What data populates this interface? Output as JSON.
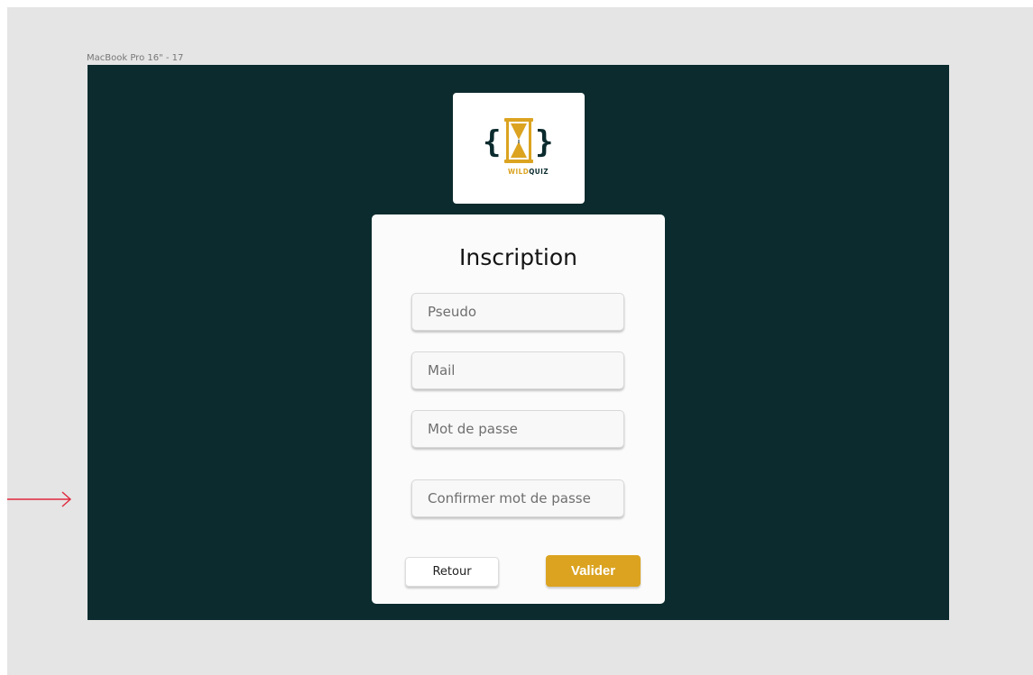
{
  "frame": {
    "label": "MacBook Pro 16\" - 17",
    "background": "#0b2b2e"
  },
  "logo": {
    "icon": "hourglass-braces-logo",
    "brand_primary": "WILD",
    "brand_secondary": "QUIZ",
    "accent_color": "#dba320",
    "dark_color": "#0b2b2e"
  },
  "form": {
    "title": "Inscription",
    "fields": [
      {
        "name": "pseudo",
        "placeholder": "Pseudo",
        "value": ""
      },
      {
        "name": "mail",
        "placeholder": "Mail",
        "value": ""
      },
      {
        "name": "password",
        "placeholder": "Mot de passe",
        "value": ""
      },
      {
        "name": "confirm",
        "placeholder": "Confirmer mot de passe",
        "value": ""
      }
    ],
    "back_label": "Retour",
    "submit_label": "Valider",
    "submit_color": "#dba320"
  },
  "annotation": {
    "icon": "arrow-right-icon",
    "color": "#e0283c"
  }
}
